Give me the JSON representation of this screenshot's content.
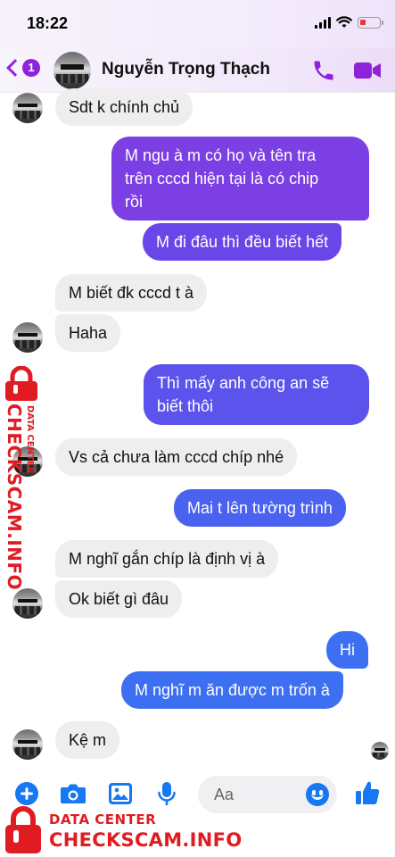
{
  "status_bar": {
    "time": "18:22"
  },
  "header": {
    "back_count": "1",
    "contact_name": "Nguyễn Trọng Thạch"
  },
  "messages": [
    {
      "from": "them",
      "text": "Sdt k chính chủ"
    },
    {
      "from": "me",
      "lines": [
        "M ngu à m có họ và tên tra",
        "trên cccd hiện tại là có chip",
        "rồi"
      ]
    },
    {
      "from": "me",
      "text": "M đi đâu thì đều biết hết"
    },
    {
      "from": "them",
      "text": "M biết đk cccd t à"
    },
    {
      "from": "them",
      "text": "Haha"
    },
    {
      "from": "me",
      "lines": [
        "Thì mấy anh công an sẽ",
        "biết thôi"
      ]
    },
    {
      "from": "them",
      "text": "Vs cả chưa làm cccd chíp nhé"
    },
    {
      "from": "me",
      "text": "Mai t lên tường trình"
    },
    {
      "from": "them",
      "text": "M nghĩ gắn chíp là định vị à"
    },
    {
      "from": "them",
      "text": "Ok biết gì đâu"
    },
    {
      "from": "me",
      "text": "Hi"
    },
    {
      "from": "me",
      "text": "M nghĩ m ăn được m trốn à"
    },
    {
      "from": "them",
      "text": "Kệ m"
    }
  ],
  "input": {
    "placeholder": "Aa"
  },
  "icons": {
    "back": "chevron-left-icon",
    "call": "phone-icon",
    "video": "video-camera-icon",
    "add": "plus-icon",
    "camera": "camera-icon",
    "gallery": "image-icon",
    "voice": "microphone-icon",
    "emoji": "smiley-icon",
    "like": "thumbs-up-icon"
  },
  "watermark": {
    "label": "DATA CENTER",
    "site": "CHECKSCAM.INFO"
  },
  "colors": {
    "accent": "#8e24d9",
    "messenger_blue": "#1877f2",
    "watermark": "#e01b22",
    "incoming_bubble": "#eeeef0"
  }
}
